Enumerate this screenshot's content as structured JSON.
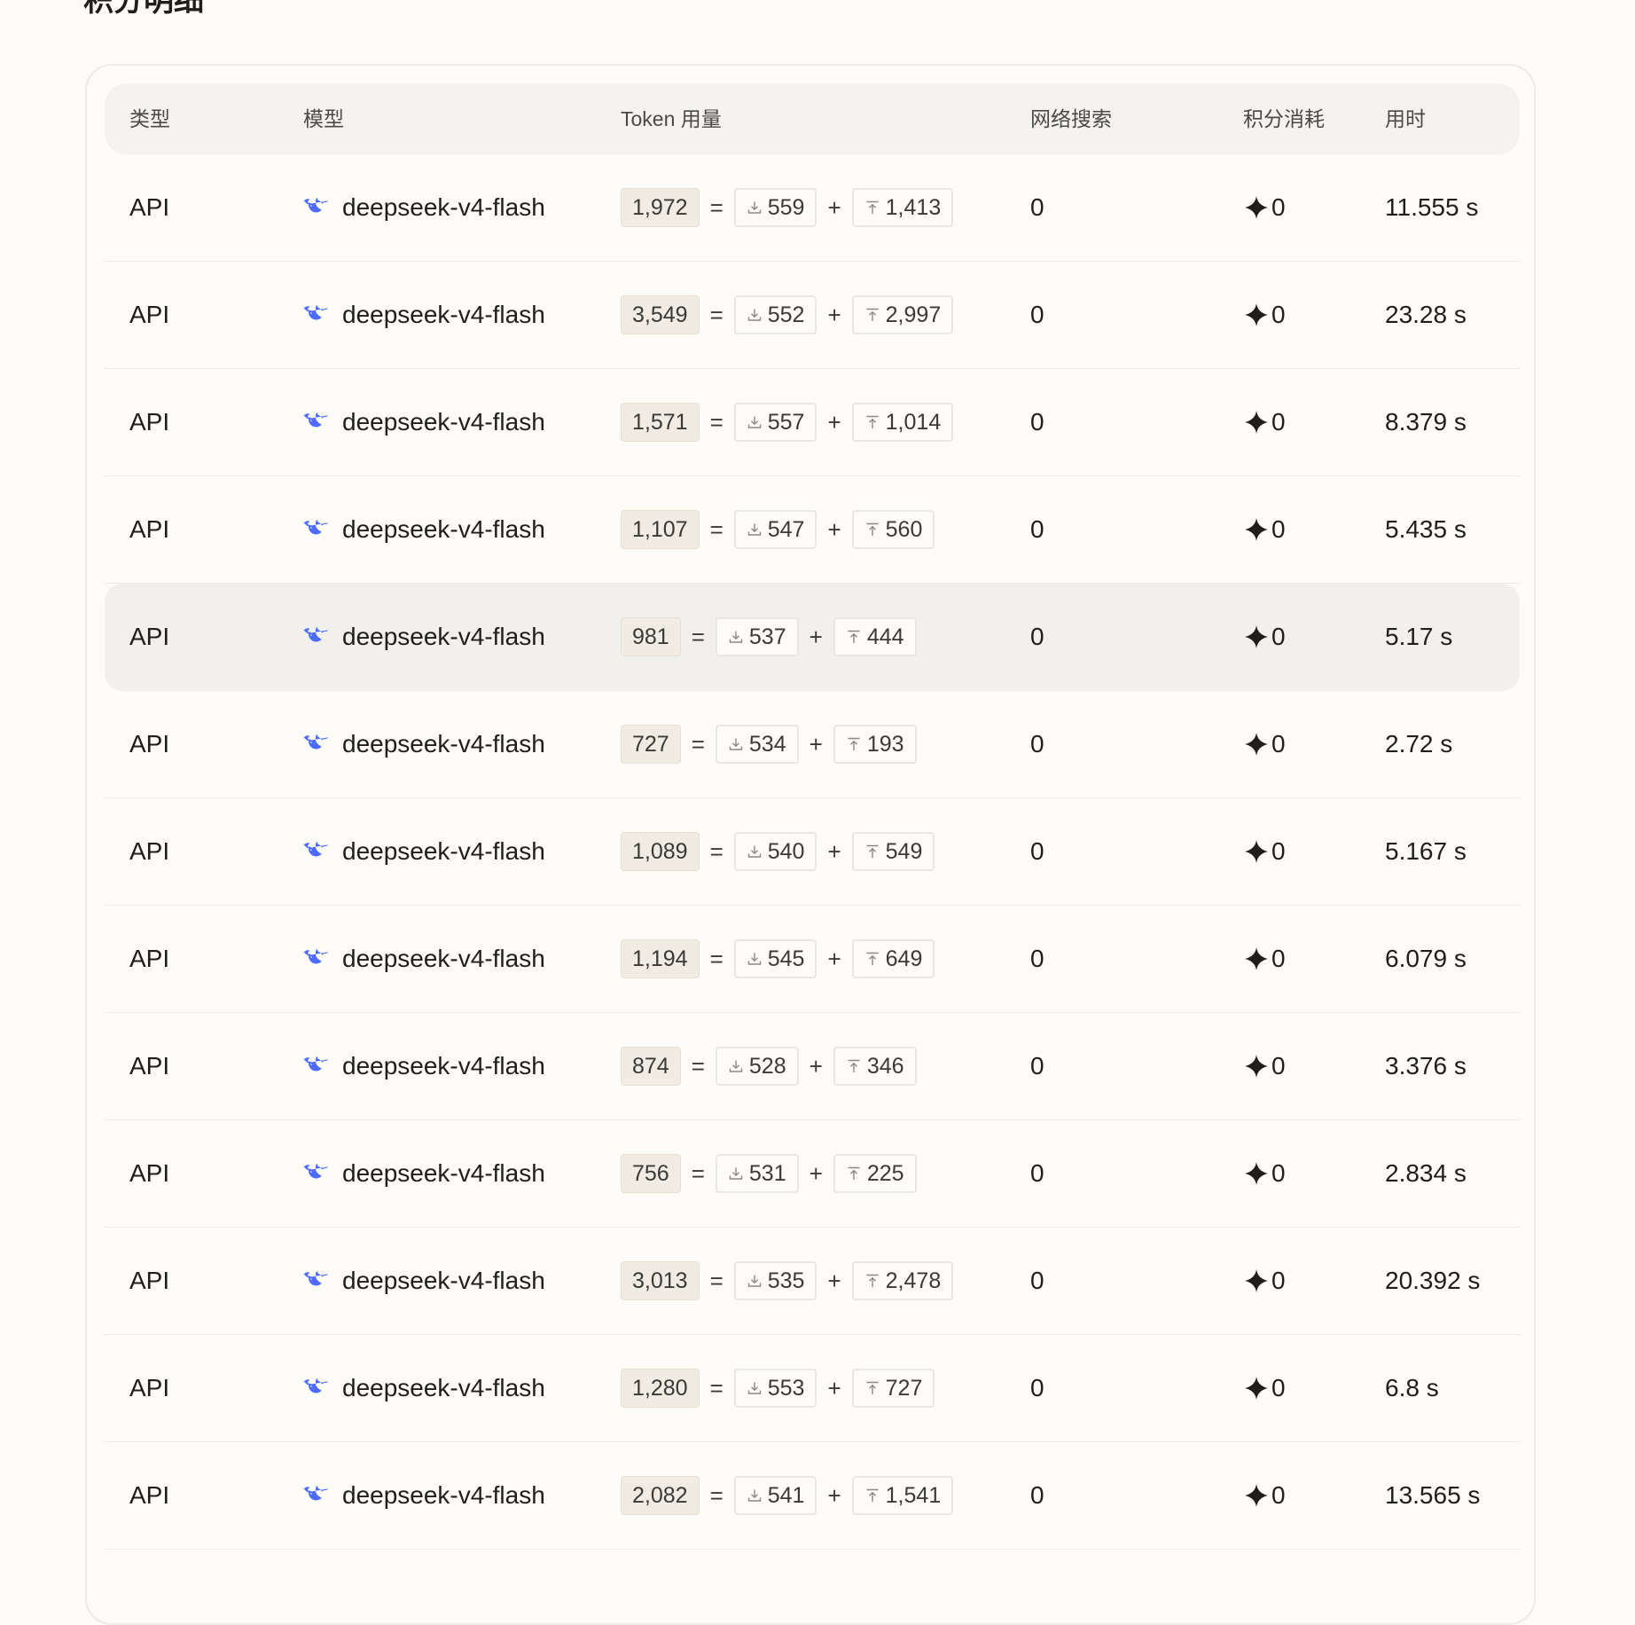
{
  "page": {
    "title": "积分明细"
  },
  "table": {
    "headers": {
      "type": "类型",
      "model": "模型",
      "token": "Token 用量",
      "web_search": "网络搜索",
      "credits": "积分消耗",
      "time": "用时"
    },
    "operators": {
      "equals": "=",
      "plus": "+"
    },
    "icons": {
      "model": "deepseek-whale-icon",
      "input": "download-icon",
      "output": "upload-icon",
      "credit": "sparkle-icon"
    },
    "colors": {
      "model_icon": "#4d6bfe",
      "total_pill_bg": "#f1ece3",
      "hover_row_bg": "#f1f0ec",
      "header_bg": "#f4f3ef"
    },
    "hovered_row": 4,
    "rows": [
      {
        "type": "API",
        "model": "deepseek-v4-flash",
        "total": "1,972",
        "input": "559",
        "output": "1,413",
        "web": "0",
        "credits": "0",
        "time": "11.555 s"
      },
      {
        "type": "API",
        "model": "deepseek-v4-flash",
        "total": "3,549",
        "input": "552",
        "output": "2,997",
        "web": "0",
        "credits": "0",
        "time": "23.28 s"
      },
      {
        "type": "API",
        "model": "deepseek-v4-flash",
        "total": "1,571",
        "input": "557",
        "output": "1,014",
        "web": "0",
        "credits": "0",
        "time": "8.379 s"
      },
      {
        "type": "API",
        "model": "deepseek-v4-flash",
        "total": "1,107",
        "input": "547",
        "output": "560",
        "web": "0",
        "credits": "0",
        "time": "5.435 s"
      },
      {
        "type": "API",
        "model": "deepseek-v4-flash",
        "total": "981",
        "input": "537",
        "output": "444",
        "web": "0",
        "credits": "0",
        "time": "5.17 s"
      },
      {
        "type": "API",
        "model": "deepseek-v4-flash",
        "total": "727",
        "input": "534",
        "output": "193",
        "web": "0",
        "credits": "0",
        "time": "2.72 s"
      },
      {
        "type": "API",
        "model": "deepseek-v4-flash",
        "total": "1,089",
        "input": "540",
        "output": "549",
        "web": "0",
        "credits": "0",
        "time": "5.167 s"
      },
      {
        "type": "API",
        "model": "deepseek-v4-flash",
        "total": "1,194",
        "input": "545",
        "output": "649",
        "web": "0",
        "credits": "0",
        "time": "6.079 s"
      },
      {
        "type": "API",
        "model": "deepseek-v4-flash",
        "total": "874",
        "input": "528",
        "output": "346",
        "web": "0",
        "credits": "0",
        "time": "3.376 s"
      },
      {
        "type": "API",
        "model": "deepseek-v4-flash",
        "total": "756",
        "input": "531",
        "output": "225",
        "web": "0",
        "credits": "0",
        "time": "2.834 s"
      },
      {
        "type": "API",
        "model": "deepseek-v4-flash",
        "total": "3,013",
        "input": "535",
        "output": "2,478",
        "web": "0",
        "credits": "0",
        "time": "20.392 s"
      },
      {
        "type": "API",
        "model": "deepseek-v4-flash",
        "total": "1,280",
        "input": "553",
        "output": "727",
        "web": "0",
        "credits": "0",
        "time": "6.8 s"
      },
      {
        "type": "API",
        "model": "deepseek-v4-flash",
        "total": "2,082",
        "input": "541",
        "output": "1,541",
        "web": "0",
        "credits": "0",
        "time": "13.565 s"
      }
    ]
  }
}
